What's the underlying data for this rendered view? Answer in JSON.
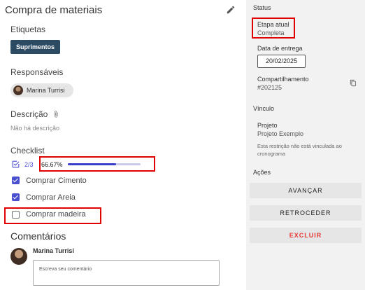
{
  "task": {
    "title": "Compra de materiais",
    "tags_label": "Etiquetas",
    "tag": "Suprimentos",
    "responsibles_label": "Responsáveis",
    "responsible": "Marina Turrisi",
    "description_label": "Descrição",
    "description_value": "Não há descrição",
    "checklist_label": "Checklist",
    "checklist_count": "2/3",
    "checklist_percent_text": "66.67%",
    "checklist_progress": 0.6667,
    "checklist_items": [
      {
        "label": "Comprar Cimento",
        "checked": true
      },
      {
        "label": "Comprar Areia",
        "checked": true
      },
      {
        "label": "Comprar madeira",
        "checked": false
      }
    ],
    "comments_label": "Comentários",
    "comment_user": "Marina Turrisi",
    "comment_placeholder": "Escreva seu comentário"
  },
  "side": {
    "status_label": "Status",
    "stage_label": "Etapa atual",
    "stage_value": "Completa",
    "delivery_label": "Data de entrega",
    "delivery_date": "20/02/2025",
    "sharing_label": "Compartilhamento",
    "sharing_id": "#202125",
    "link_label": "Vínculo",
    "project_label": "Projeto",
    "project_value": "Projeto Exemplo",
    "restriction_note": "Esta restrição não está vinculada ao cronograma",
    "actions_label": "Ações",
    "btn_advance": "AVANÇAR",
    "btn_back": "RETROCEDER",
    "btn_delete": "EXCLUIR"
  },
  "colors": {
    "tag_bg": "#2d4a63",
    "checkbox": "#4a4fd1",
    "highlight": "#e00000",
    "danger": "#e53935"
  }
}
